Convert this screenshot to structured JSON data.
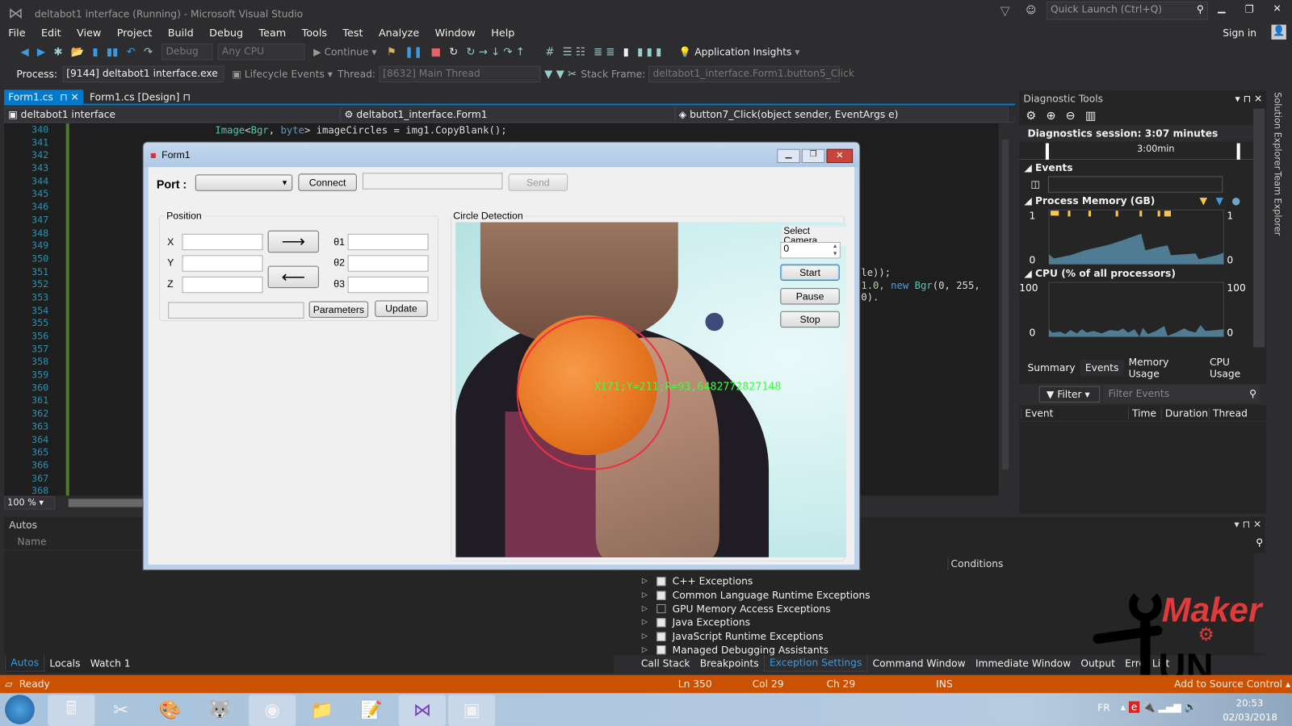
{
  "window": {
    "title": "deltabot1 interface (Running) - Microsoft Visual Studio",
    "quick_launch_placeholder": "Quick Launch (Ctrl+Q)",
    "sign_in": "Sign in"
  },
  "menu": [
    "File",
    "Edit",
    "View",
    "Project",
    "Build",
    "Debug",
    "Team",
    "Tools",
    "Test",
    "Analyze",
    "Window",
    "Help"
  ],
  "toolbar": {
    "config": "Debug",
    "platform": "Any CPU",
    "continue": "Continue",
    "app_insights": "Application Insights"
  },
  "debugbar": {
    "process_label": "Process:",
    "process": "[9144] deltabot1 interface.exe",
    "lifecycle": "Lifecycle Events",
    "thread_label": "Thread:",
    "thread": "[8632] Main Thread",
    "stack_label": "Stack Frame:",
    "stack": "deltabot1_interface.Form1.button5_Click"
  },
  "tabs": [
    {
      "label": "Form1.cs",
      "active": true
    },
    {
      "label": "Form1.cs [Design]",
      "active": false
    }
  ],
  "nav": {
    "project": "deltabot1 interface",
    "class": "deltabot1_interface.Form1",
    "member": "button7_Click(object sender, EventArgs e)"
  },
  "code": {
    "line_numbers": [
      "340",
      "341",
      "342",
      "343",
      "344",
      "345",
      "346",
      "347",
      "348",
      "349",
      "350",
      "351",
      "352",
      "353",
      "354",
      "355",
      "356",
      "357",
      "358",
      "359",
      "360",
      "361",
      "362",
      "363",
      "364",
      "365",
      "366",
      "367",
      "368"
    ],
    "line340": {
      "type": "Image",
      "lt": "<",
      "t1": "Bgr",
      ",": ", ",
      "t2": "byte",
      "rest": "> imageCircles = img1.CopyBlank();"
    },
    "line351_tail": "le));",
    "line352_tail_a": "1.0, ",
    "line352_kw": "new ",
    "line352_type": "Bgr",
    "line352_rest": "(0, 255, 0)."
  },
  "zoom": "100 %",
  "form": {
    "title": "Form1",
    "port_label": "Port :",
    "connect": "Connect",
    "send": "Send",
    "position": {
      "label": "Position",
      "x": "X",
      "y": "Y",
      "z": "Z",
      "t1": "θ1",
      "t2": "θ2",
      "t3": "θ3",
      "forward": "⟶",
      "back": "⟵",
      "parameters": "Parameters",
      "update": "Update"
    },
    "circle": {
      "label": "Circle Detection",
      "select_camera": "Select Camera",
      "camera_value": "0",
      "start": "Start",
      "pause": "Pause",
      "stop": "Stop",
      "overlay": "X171;Y=211;R=93,6482772827148"
    }
  },
  "diagnostics": {
    "title": "Diagnostic Tools",
    "session": "Diagnostics session: 3:07 minutes",
    "timeline": "3:00min",
    "events": "Events",
    "memory": {
      "label": "Process Memory (GB)",
      "max": "1",
      "min": "0"
    },
    "cpu": {
      "label": "CPU (% of all processors)",
      "max": "100",
      "min": "0"
    },
    "tabs": [
      "Summary",
      "Events",
      "Memory Usage",
      "CPU Usage"
    ],
    "active_tab": "Events",
    "filter": "Filter",
    "filter_placeholder": "Filter Events",
    "columns": [
      "Event",
      "Time",
      "Duration",
      "Thread"
    ]
  },
  "autos": {
    "title": "Autos",
    "column": "Name",
    "tabs": [
      "Autos",
      "Locals",
      "Watch 1"
    ]
  },
  "exceptions": {
    "column": "Conditions",
    "items": [
      {
        "label": "C++ Exceptions",
        "checked": true
      },
      {
        "label": "Common Language Runtime Exceptions",
        "checked": true
      },
      {
        "label": "GPU Memory Access Exceptions",
        "checked": false
      },
      {
        "label": "Java Exceptions",
        "checked": true
      },
      {
        "label": "JavaScript Runtime Exceptions",
        "checked": true
      },
      {
        "label": "Managed Debugging Assistants",
        "checked": true
      }
    ],
    "tabs": [
      "Call Stack",
      "Breakpoints",
      "Exception Settings",
      "Command Window",
      "Immediate Window",
      "Output",
      "Error List"
    ],
    "active_tab": "Exception Settings"
  },
  "status": {
    "ready": "Ready",
    "ln": "Ln 350",
    "col": "Col 29",
    "ch": "Ch 29",
    "ins": "INS",
    "source_control": "Add to Source Control",
    "color": "#ca5100"
  },
  "watermark": {
    "text": "Maker UN"
  },
  "taskbar": {
    "lang": "FR",
    "time": "20:53",
    "date": "02/03/2018"
  }
}
